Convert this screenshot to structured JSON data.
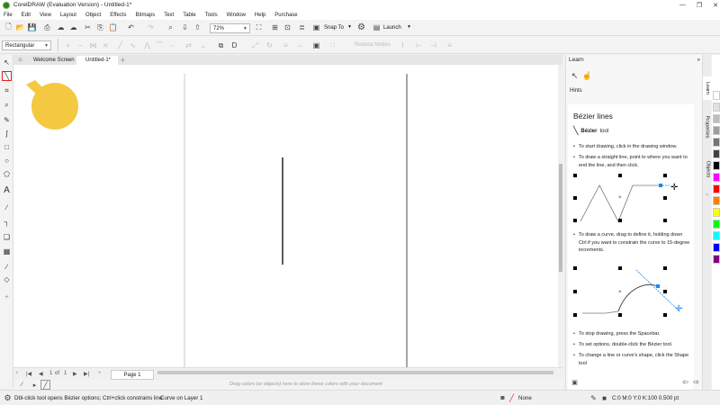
{
  "window": {
    "title": "CorelDRAW (Evaluation Version) - Untitled-1*",
    "controls": [
      "—",
      "❐",
      "✕"
    ]
  },
  "menu": [
    "File",
    "Edit",
    "View",
    "Layout",
    "Object",
    "Effects",
    "Bitmaps",
    "Text",
    "Table",
    "Tools",
    "Window",
    "Help",
    "Purchase"
  ],
  "toolbar": {
    "zoom_value": "72%",
    "snap_label": "Snap To",
    "launch_label": "Launch"
  },
  "property_bar": {
    "mode_value": "Rectangular",
    "reduce_nodes_label": "Reduce Nodes"
  },
  "tabs": {
    "welcome": "Welcome Screen",
    "document": "Untitled-1*",
    "add": "+"
  },
  "page_nav": {
    "first": "|◀",
    "prev": "◀",
    "current": "1",
    "of_label": "of",
    "total": "1",
    "next": "▶",
    "last": "▶|",
    "add": "+",
    "page_label": "Page 1"
  },
  "palette_hint": "Drag colors (or objects) here to store these colors with your document",
  "status": {
    "hint": "Dbl-click tool opens Bézier options; Ctrl+click constrains line",
    "object_info": "Curve on Layer 1",
    "fill_label": "None",
    "outline_info": "C:0 M:0 Y:0 K:100  0.500 pt"
  },
  "panel": {
    "title": "Learn",
    "hints_label": "Hints",
    "doc_title": "Bézier lines",
    "tool_name": "Bézier",
    "tool_suffix": "tool",
    "bullets": [
      "To start drawing, click in the drawing window.",
      "To draw a straight line, point to where you want to end the line, and then click.",
      "To draw a curve, drag to define it, holding down Ctrl if you want to constrain the curve to 15-degree increments.",
      "To stop drawing, press the Spacebar.",
      "To set options, double-click the Bézier tool.",
      "To change a line or curve's shape, click the Shape tool"
    ]
  },
  "dock_tabs": [
    "Learn",
    "Properties",
    "Objects"
  ],
  "colors": {
    "accent": "#1e88e5",
    "selection": "#e02020",
    "hand": "#f5c842",
    "palette": [
      "#ffffff",
      "#e0e0e0",
      "#bdbdbd",
      "#9e9e9e",
      "#757575",
      "#424242",
      "#000000",
      "#ff00ff",
      "#ff0000",
      "#ff8000",
      "#ffff00",
      "#00ff00",
      "#00ffff",
      "#0000ff",
      "#800080"
    ]
  },
  "icons": {
    "toolbox": [
      "pick-tool-icon",
      "bezier-tool-icon",
      "crop-tool-icon",
      "zoom-tool-icon",
      "freehand-tool-icon",
      "artistic-media-icon",
      "rectangle-tool-icon",
      "ellipse-tool-icon",
      "polygon-tool-icon",
      "text-tool-icon",
      "parallel-dimension-icon",
      "connector-tool-icon",
      "drop-shadow-icon",
      "transparency-icon",
      "eyedropper-icon",
      "interactive-fill-icon",
      "add-tool-icon"
    ]
  }
}
